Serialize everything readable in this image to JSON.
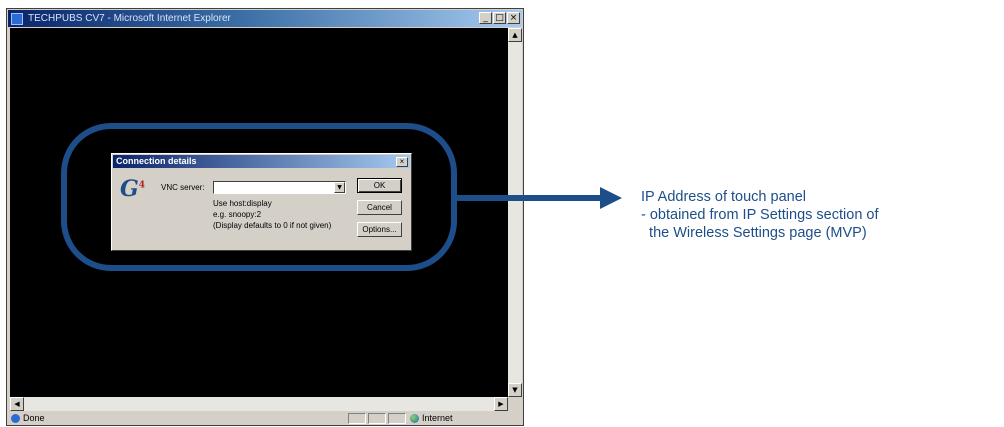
{
  "window": {
    "title": "TECHPUBS CV7 - Microsoft Internet Explorer",
    "min_glyph": "_",
    "max_glyph": "□",
    "close_glyph": "×"
  },
  "statusbar": {
    "status_text": "Done",
    "zone_text": "Internet"
  },
  "dialog": {
    "title": "Connection details",
    "close_glyph": "×",
    "logo_text": "G",
    "logo_sup": "4",
    "vnc_label": "VNC server:",
    "vnc_value": "",
    "hint_lines": [
      "Use host:display",
      "e.g. snoopy:2",
      "(Display defaults to 0 if not given)"
    ],
    "buttons": {
      "ok": "OK",
      "cancel": "Cancel",
      "options": "Options..."
    }
  },
  "annotation": {
    "line1": "IP Address of touch panel",
    "line2": "- obtained from IP Settings section of",
    "line3": "  the Wireless Settings page (MVP)"
  },
  "colors": {
    "accent": "#1d4e89"
  }
}
